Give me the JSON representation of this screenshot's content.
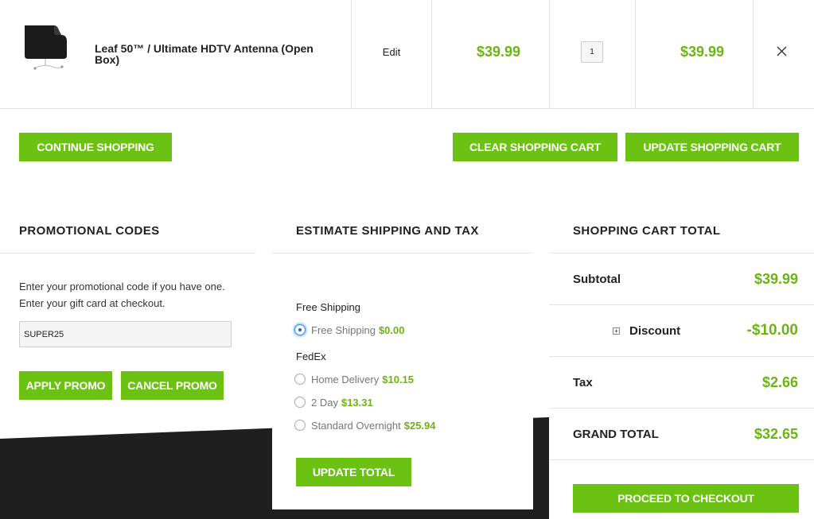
{
  "cart": {
    "item": {
      "name": "Leaf 50™ / Ultimate HDTV Antenna (Open Box)",
      "edit_label": "Edit",
      "price": "$39.99",
      "quantity": "1",
      "subtotal": "$39.99",
      "image_icon": "antenna-product-image",
      "remove_icon": "close-icon"
    },
    "buttons": {
      "continue": "CONTINUE SHOPPING",
      "clear": "CLEAR SHOPPING CART",
      "update": "UPDATE SHOPPING CART"
    }
  },
  "promo": {
    "title": "PROMOTIONAL CODES",
    "line1": "Enter your promotional code if you have one.",
    "line2": "Enter your gift card at checkout.",
    "code_value": "SUPER25",
    "apply_label": "APPLY PROMO",
    "cancel_label": "CANCEL PROMO"
  },
  "shipping": {
    "title": "ESTIMATE SHIPPING AND TAX",
    "groups": [
      {
        "name": "Free Shipping",
        "options": [
          {
            "label": "Free Shipping",
            "price": "$0.00",
            "selected": true
          }
        ]
      },
      {
        "name": "FedEx",
        "options": [
          {
            "label": "Home Delivery",
            "price": "$10.15",
            "selected": false
          },
          {
            "label": "2 Day",
            "price": "$13.31",
            "selected": false
          },
          {
            "label": "Standard Overnight",
            "price": "$25.94",
            "selected": false
          }
        ]
      }
    ],
    "update_label": "UPDATE TOTAL"
  },
  "totals": {
    "title": "SHOPPING CART TOTAL",
    "subtotal_label": "Subtotal",
    "subtotal_value": "$39.99",
    "discount_label": "Discount",
    "discount_value": "-$10.00",
    "tax_label": "Tax",
    "tax_value": "$2.66",
    "grand_label": "GRAND TOTAL",
    "grand_value": "$32.65",
    "checkout_label": "PROCEED TO CHECKOUT"
  },
  "colors": {
    "accent_green": "#6cc212",
    "price_green": "#6cb414",
    "dark_band": "#1f1f1f"
  }
}
